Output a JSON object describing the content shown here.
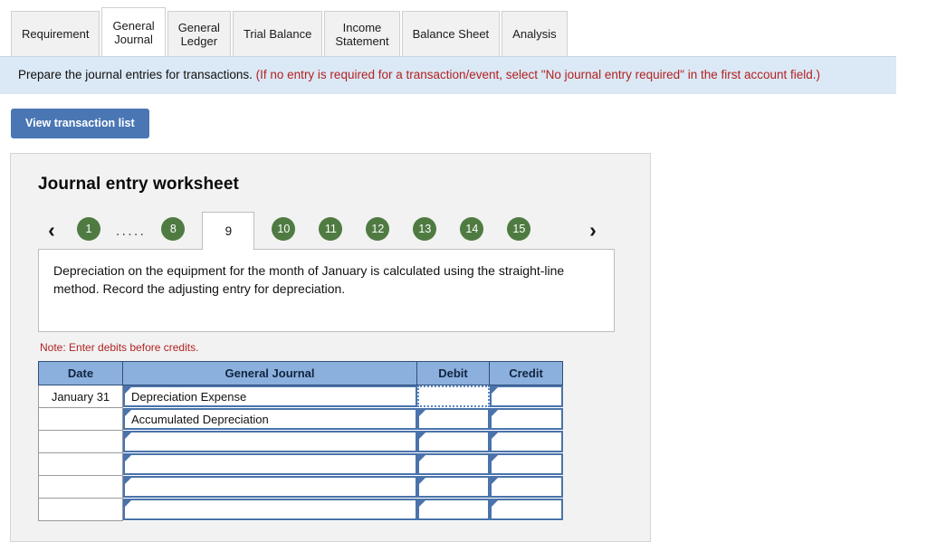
{
  "tabs": [
    {
      "label": "Requirement",
      "active": false
    },
    {
      "label": "General\nJournal",
      "active": true
    },
    {
      "label": "General\nLedger",
      "active": false
    },
    {
      "label": "Trial Balance",
      "active": false
    },
    {
      "label": "Income\nStatement",
      "active": false
    },
    {
      "label": "Balance Sheet",
      "active": false
    },
    {
      "label": "Analysis",
      "active": false
    }
  ],
  "banner": {
    "text_black": "Prepare the journal entries for transactions.",
    "text_red": "(If no entry is required for a transaction/event, select \"No journal entry required\" in the first account field.)"
  },
  "toolbar": {
    "view_transaction_list_label": "View transaction list"
  },
  "worksheet": {
    "title": "Journal entry worksheet",
    "pager": {
      "prev_icon": "‹",
      "next_icon": "›",
      "first_page": "1",
      "ellipsis": ".....",
      "page_before_active": "8",
      "active_page": "9",
      "pages_after": [
        "10",
        "11",
        "12",
        "13",
        "14",
        "15"
      ]
    },
    "question": "Depreciation on the equipment for the month of January is calculated using the straight-line method. Record the adjusting entry for depreciation.",
    "note": "Note: Enter debits before credits.",
    "table": {
      "headers": [
        "Date",
        "General Journal",
        "Debit",
        "Credit"
      ],
      "rows": [
        {
          "date": "January 31",
          "account": "Depreciation Expense",
          "debit": "",
          "credit": "",
          "debit_focused": true
        },
        {
          "date": "",
          "account": "Accumulated Depreciation",
          "debit": "",
          "credit": "",
          "debit_focused": false
        },
        {
          "date": "",
          "account": "",
          "debit": "",
          "credit": "",
          "debit_focused": false
        },
        {
          "date": "",
          "account": "",
          "debit": "",
          "credit": "",
          "debit_focused": false
        },
        {
          "date": "",
          "account": "",
          "debit": "",
          "credit": "",
          "debit_focused": false
        },
        {
          "date": "",
          "account": "",
          "debit": "",
          "credit": "",
          "debit_focused": false
        }
      ]
    }
  },
  "colors": {
    "accent_blue": "#4a77b4",
    "pager_green": "#4f7b42",
    "table_header_blue": "#8cb0dd",
    "cell_border_blue": "#4a73ab",
    "banner_blue": "#dbe8f5",
    "note_red": "#b22222",
    "panel_gray": "#f2f2f2"
  }
}
